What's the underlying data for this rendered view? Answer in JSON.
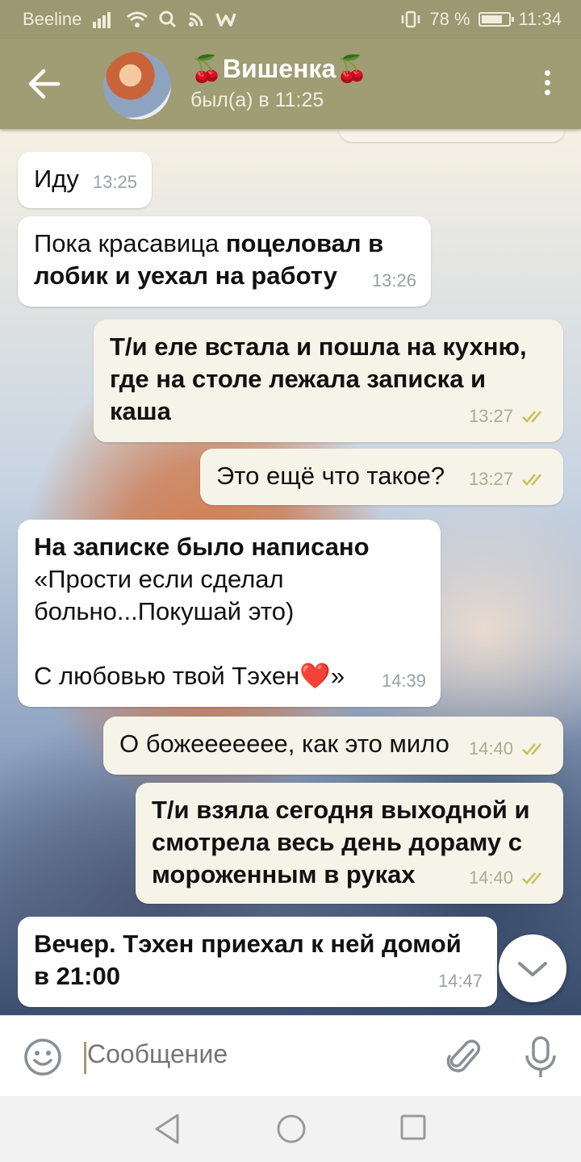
{
  "status_bar": {
    "carrier": "Beeline",
    "battery": "78 %",
    "battery_level": 0.78,
    "time": "11:34"
  },
  "header": {
    "contact_name": "🍒Вишенка🍒",
    "last_seen": "был(а) в 11:25"
  },
  "messages": [
    {
      "direction": "in",
      "text": "Иду",
      "time": "13:25",
      "bold": false
    },
    {
      "direction": "in",
      "text_plain": "Пока красавица ",
      "text_bold": "поцеловал в\nлобик и уехал на работу",
      "time": "13:26"
    },
    {
      "direction": "out",
      "text": "Т/и еле встала и пошла на кухню,\nгде на столе лежала записка и\nкаша",
      "time": "13:27",
      "bold": true,
      "status": "read"
    },
    {
      "direction": "out",
      "text": "Это ещё что такое?",
      "time": "13:27",
      "bold": false,
      "status": "read"
    },
    {
      "direction": "in",
      "text_bold": "На записке было написано",
      "text_plain": "\n«Прости если сделал\nбольно...Покушай это)\n\nС любовью твой Тэхен❤️»",
      "time": "14:39"
    },
    {
      "direction": "out",
      "text": "О божеееееее, как это мило",
      "time": "14:40",
      "bold": false,
      "status": "read"
    },
    {
      "direction": "out",
      "text": "Т/и взяла сегодня выходной и\nсмотрела весь день дораму с\nмороженным в руках",
      "time": "14:40",
      "bold": true,
      "status": "read"
    },
    {
      "direction": "in",
      "text": "Вечер. Тэхен приехал к ней домой\nв 21:00",
      "time": "14:47",
      "bold": true
    }
  ],
  "input": {
    "placeholder": "Сообщение"
  },
  "icons": {
    "back": "arrow-left-icon",
    "menu": "more-vertical-icon",
    "emoji": "smile-icon",
    "attach": "paperclip-icon",
    "mic": "microphone-icon",
    "scroll_down": "chevron-down-icon",
    "read": "double-check-icon"
  },
  "colors": {
    "header": "#a09c73",
    "accent_check": "#c9bd55"
  }
}
